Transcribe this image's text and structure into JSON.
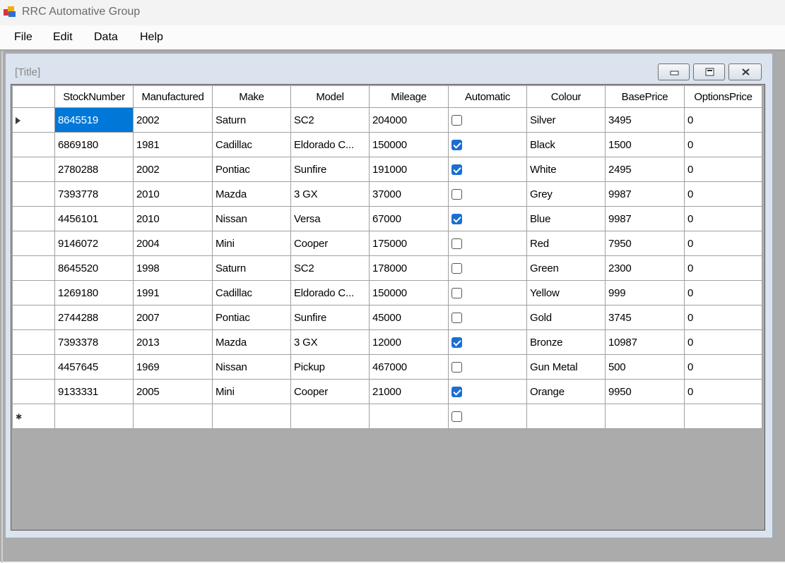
{
  "app": {
    "title": "RRC Automative Group",
    "menu": [
      "File",
      "Edit",
      "Data",
      "Help"
    ]
  },
  "child": {
    "title": "[Title]"
  },
  "colors": {
    "selection": "#0078d7",
    "checkbox_checked": "#1a6fd1",
    "mdi_background": "#ababab"
  },
  "grid": {
    "columns": [
      "StockNumber",
      "Manufactured",
      "Make",
      "Model",
      "Mileage",
      "Automatic",
      "Colour",
      "BasePrice",
      "OptionsPrice"
    ],
    "rows": [
      {
        "stock": "8645519",
        "year": "2002",
        "make": "Saturn",
        "model": "SC2",
        "mileage": "204000",
        "automatic": false,
        "colour": "Silver",
        "base": "3495",
        "options": "0"
      },
      {
        "stock": "6869180",
        "year": "1981",
        "make": "Cadillac",
        "model": "Eldorado C...",
        "mileage": "150000",
        "automatic": true,
        "colour": "Black",
        "base": "1500",
        "options": "0"
      },
      {
        "stock": "2780288",
        "year": "2002",
        "make": "Pontiac",
        "model": "Sunfire",
        "mileage": "191000",
        "automatic": true,
        "colour": "White",
        "base": "2495",
        "options": "0"
      },
      {
        "stock": "7393778",
        "year": "2010",
        "make": "Mazda",
        "model": "3 GX",
        "mileage": "37000",
        "automatic": false,
        "colour": "Grey",
        "base": "9987",
        "options": "0"
      },
      {
        "stock": "4456101",
        "year": "2010",
        "make": "Nissan",
        "model": "Versa",
        "mileage": "67000",
        "automatic": true,
        "colour": "Blue",
        "base": "9987",
        "options": "0"
      },
      {
        "stock": "9146072",
        "year": "2004",
        "make": "Mini",
        "model": "Cooper",
        "mileage": "175000",
        "automatic": false,
        "colour": "Red",
        "base": "7950",
        "options": "0"
      },
      {
        "stock": "8645520",
        "year": "1998",
        "make": "Saturn",
        "model": "SC2",
        "mileage": "178000",
        "automatic": false,
        "colour": "Green",
        "base": "2300",
        "options": "0"
      },
      {
        "stock": "1269180",
        "year": "1991",
        "make": "Cadillac",
        "model": "Eldorado C...",
        "mileage": "150000",
        "automatic": false,
        "colour": "Yellow",
        "base": "999",
        "options": "0"
      },
      {
        "stock": "2744288",
        "year": "2007",
        "make": "Pontiac",
        "model": "Sunfire",
        "mileage": "45000",
        "automatic": false,
        "colour": "Gold",
        "base": "3745",
        "options": "0"
      },
      {
        "stock": "7393378",
        "year": "2013",
        "make": "Mazda",
        "model": "3 GX",
        "mileage": "12000",
        "automatic": true,
        "colour": "Bronze",
        "base": "10987",
        "options": "0"
      },
      {
        "stock": "4457645",
        "year": "1969",
        "make": "Nissan",
        "model": "Pickup",
        "mileage": "467000",
        "automatic": false,
        "colour": "Gun Metal",
        "base": "500",
        "options": "0"
      },
      {
        "stock": "9133331",
        "year": "2005",
        "make": "Mini",
        "model": "Cooper",
        "mileage": "21000",
        "automatic": true,
        "colour": "Orange",
        "base": "9950",
        "options": "0"
      }
    ],
    "new_row_automatic": false,
    "current_row_icon": "row-pointer-arrow-icon",
    "new_row_icon": "new-row-star-icon"
  }
}
